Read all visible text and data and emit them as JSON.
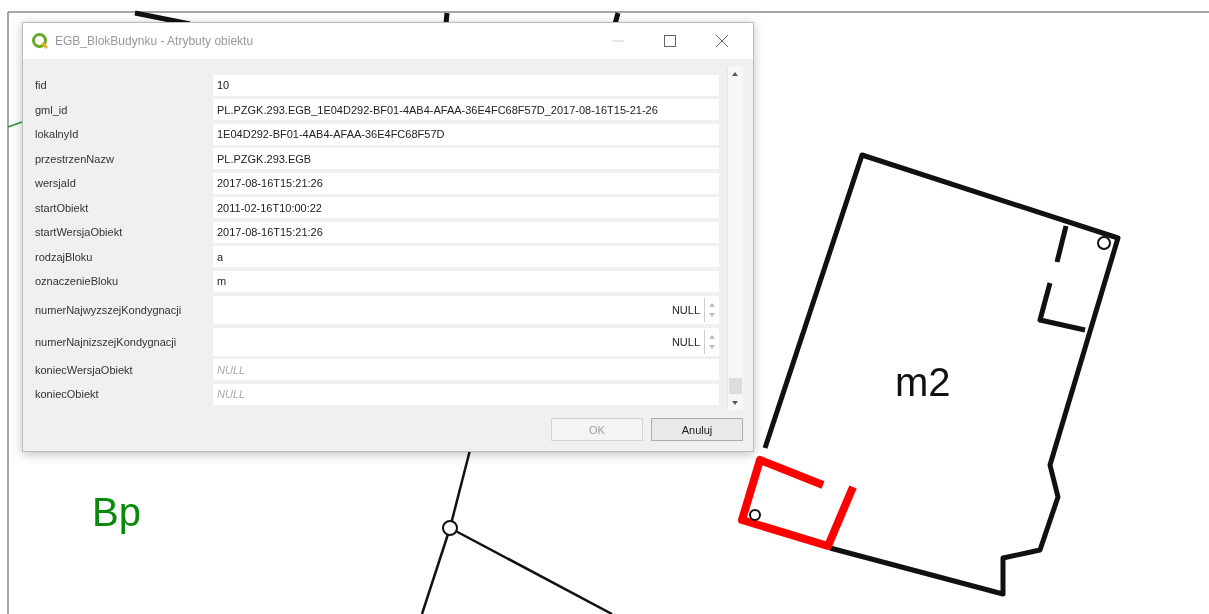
{
  "map": {
    "labels": [
      {
        "text": "m2",
        "kind": "building"
      },
      {
        "text": "Bp",
        "kind": "landuse"
      }
    ]
  },
  "dialog": {
    "title": "EGB_BlokBudynku - Atrybuty obiektu",
    "fields": [
      {
        "label": "fid",
        "kind": "text",
        "value": "10"
      },
      {
        "label": "gml_id",
        "kind": "text",
        "value": "PL.PZGK.293.EGB_1E04D292-BF01-4AB4-AFAA-36E4FC68F57D_2017-08-16T15-21-26"
      },
      {
        "label": "lokalnyId",
        "kind": "text",
        "value": "1E04D292-BF01-4AB4-AFAA-36E4FC68F57D"
      },
      {
        "label": "przestrzenNazw",
        "kind": "text",
        "value": "PL.PZGK.293.EGB"
      },
      {
        "label": "wersjaId",
        "kind": "text",
        "value": "2017-08-16T15:21:26"
      },
      {
        "label": "startObiekt",
        "kind": "text",
        "value": "2011-02-16T10:00:22"
      },
      {
        "label": "startWersjaObiekt",
        "kind": "text",
        "value": "2017-08-16T15:21:26"
      },
      {
        "label": "rodzajBloku",
        "kind": "text",
        "value": "a"
      },
      {
        "label": "oznaczenieBloku",
        "kind": "text",
        "value": "m"
      },
      {
        "label": "numerNajwyzszejKondygnacji",
        "kind": "spin",
        "value": "NULL"
      },
      {
        "label": "numerNajnizszejKondygnacji",
        "kind": "spin",
        "value": "NULL"
      },
      {
        "label": "koniecWersjaObiekt",
        "kind": "text",
        "placeholder": "NULL"
      },
      {
        "label": "koniecObiekt",
        "kind": "text",
        "placeholder": "NULL"
      }
    ],
    "buttons": [
      {
        "label": "OK",
        "disabled": true
      },
      {
        "label": "Anuluj",
        "disabled": false
      }
    ]
  }
}
